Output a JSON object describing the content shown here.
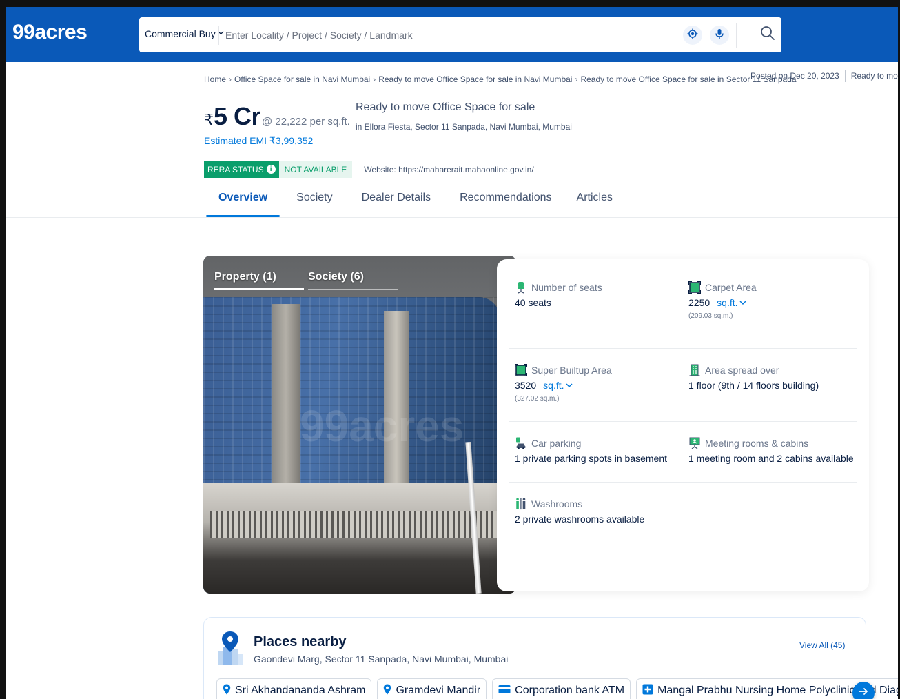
{
  "header": {
    "logo": "99acres",
    "search": {
      "category": "Commercial Buy",
      "placeholder": "Enter Locality / Project / Society / Landmark"
    }
  },
  "breadcrumb": [
    "Home",
    "Office Space for sale in Navi Mumbai",
    "Ready to move Office Space for sale in Navi Mumbai",
    "Ready to move Office Space for sale in Sector 11 Sanpada"
  ],
  "meta": {
    "posted": "Posted on Dec 20, 2023",
    "status": "Ready to move"
  },
  "price": {
    "currency": "₹",
    "amount": "5 Cr",
    "per_sqft": "@ 22,222 per sq.ft.",
    "emi": "Estimated EMI ₹3,99,352"
  },
  "property": {
    "title": "Ready to move Office Space for sale",
    "address": "in Ellora Fiesta, Sector 11 Sanpada, Navi Mumbai, Mumbai"
  },
  "rera": {
    "label": "RERA STATUS",
    "info": "i",
    "value": "NOT AVAILABLE",
    "website": "Website: https://maharerait.mahaonline.gov.in/"
  },
  "tabs": [
    "Overview",
    "Society",
    "Dealer Details",
    "Recommendations",
    "Articles"
  ],
  "gallery": {
    "tabs": [
      "Property (1)",
      "Society (6)"
    ],
    "watermark": "99acres"
  },
  "details": [
    [
      {
        "label": "Number of seats",
        "value": "40 seats",
        "icon": "chair-icon"
      },
      {
        "label": "Carpet Area",
        "value": "2250",
        "unit": "sq.ft.",
        "sub": "(209.03 sq.m.)",
        "icon": "area-icon"
      }
    ],
    [
      {
        "label": "Super Builtup Area",
        "value": "3520",
        "unit": "sq.ft.",
        "sub": "(327.02 sq.m.)",
        "icon": "area-icon"
      },
      {
        "label": "Area spread over",
        "value": "1 floor (9th / 14 floors building)",
        "icon": "building-icon"
      }
    ],
    [
      {
        "label": "Car parking",
        "value": "1 private parking spots in basement",
        "icon": "car-icon"
      },
      {
        "label": "Meeting rooms & cabins",
        "value": "1 meeting room and 2 cabins available",
        "icon": "meeting-icon"
      }
    ],
    [
      {
        "label": "Washrooms",
        "value": "2 private washrooms available",
        "icon": "washroom-icon"
      }
    ]
  ],
  "places": {
    "title": "Places nearby",
    "address": "Gaondevi Marg, Sector 11 Sanpada, Navi Mumbai, Mumbai",
    "view_all": "View All (45)",
    "chips": [
      {
        "label": "Sri Akhandananda Ashram",
        "icon": "location-pin-icon"
      },
      {
        "label": "Gramdevi Mandir",
        "icon": "location-pin-icon"
      },
      {
        "label": "Corporation bank ATM",
        "icon": "card-icon"
      },
      {
        "label": "Mangal Prabhu Nursing Home Polyclinic and Diag",
        "icon": "hospital-icon"
      }
    ]
  },
  "colors": {
    "brand": "#0a59b8",
    "link": "#0078db",
    "rera_green": "#0a9e6b"
  }
}
